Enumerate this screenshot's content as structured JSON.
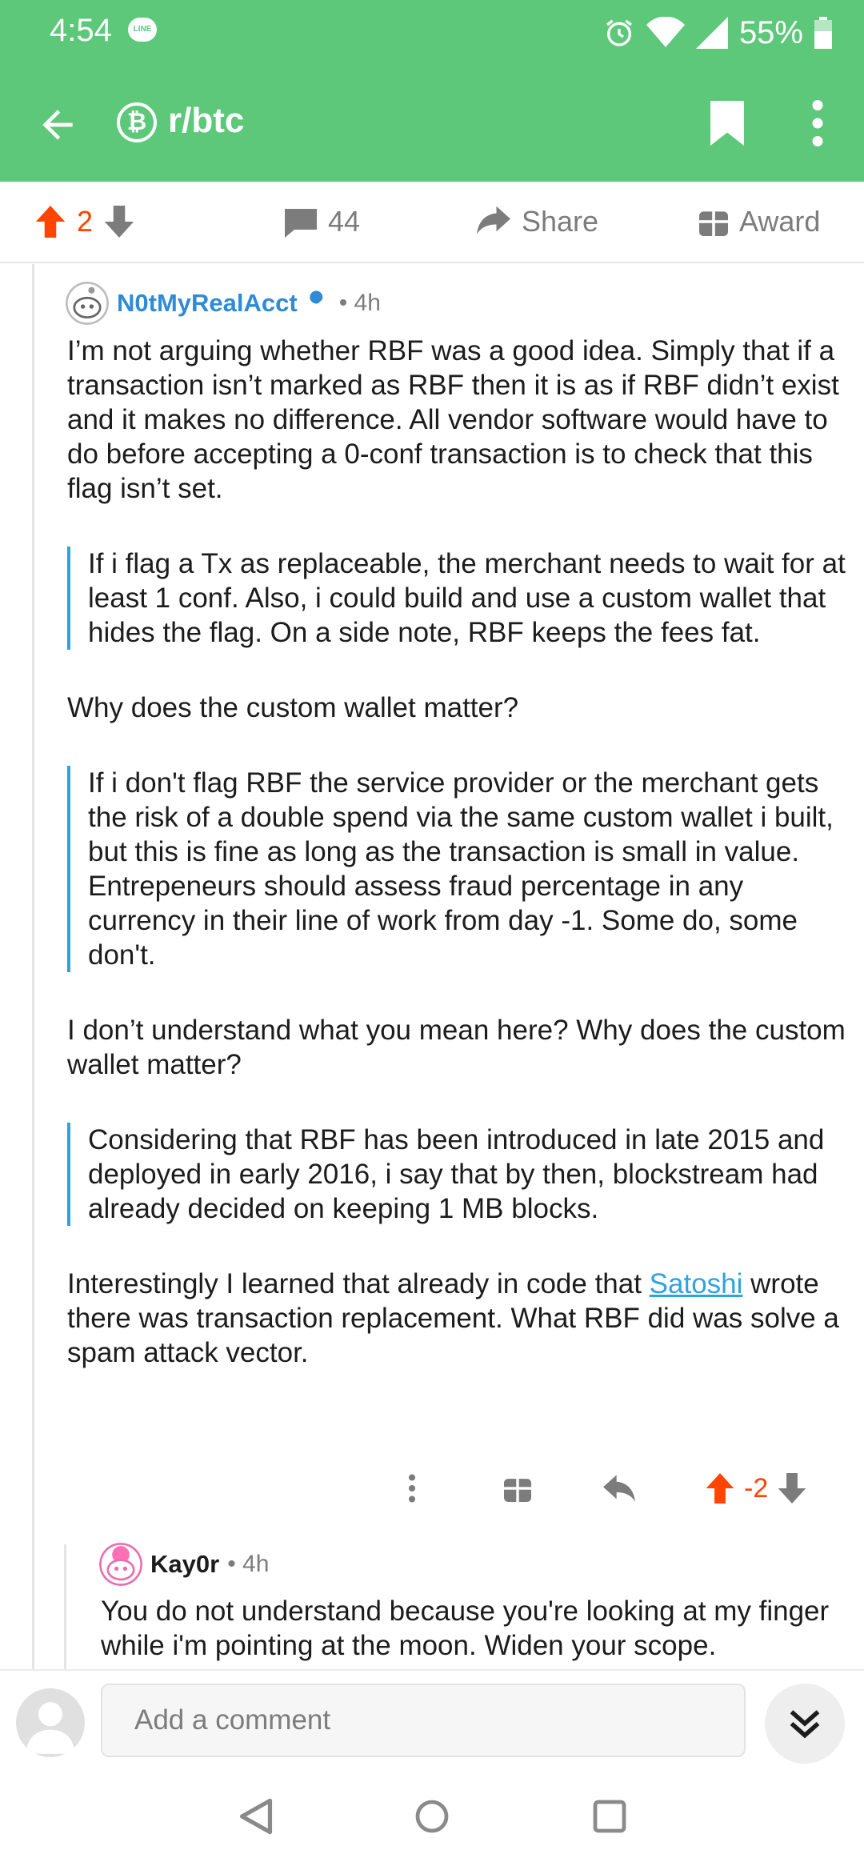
{
  "status_bar": {
    "time": "4:54",
    "line_badge": "LINE",
    "battery": "55%",
    "icons": [
      "alarm-icon",
      "wifi-icon",
      "signal-icon",
      "battery-icon"
    ]
  },
  "app_bar": {
    "subreddit": "r/btc",
    "subreddit_icon_glyph": "₿",
    "icons": [
      "back-arrow-icon",
      "bookmark-icon",
      "more-vertical-icon"
    ]
  },
  "post_actions": {
    "upvotes": "2",
    "comments": "44",
    "share_label": "Share",
    "award_label": "Award"
  },
  "comment": {
    "author": "N0tMyRealAcct",
    "age": "• 4h",
    "paragraphs": [
      {
        "type": "text",
        "text": "I’m not arguing whether RBF was a good idea. Simply that if a transaction isn’t marked as RBF then it is as if RBF didn’t exist and it makes no difference. All vendor software would have to do before accepting a 0-conf transaction is to check that this flag isn’t set."
      },
      {
        "type": "quote",
        "text": "If i flag a Tx as replaceable, the merchant needs to wait for at least 1 conf. Also, i could build and use a custom wallet that hides the flag. On a side note, RBF keeps the fees fat."
      },
      {
        "type": "text",
        "text": "Why does the custom wallet matter?"
      },
      {
        "type": "quote",
        "text": "If i don't flag RBF the service provider or the merchant gets the risk of a double spend via the same custom wallet i built, but this is fine as long as the transaction is small in value. Entrepeneurs should assess fraud percentage in any currency in their line of work from day -1. Some do, some don't."
      },
      {
        "type": "text",
        "text": "I don’t understand what you mean here? Why does the custom wallet matter?"
      },
      {
        "type": "quote",
        "text": "Considering that RBF has been introduced in late 2015 and deployed in early 2016, i say that by then, blockstream had already decided on keeping 1 MB blocks."
      }
    ],
    "last_paragraph": {
      "before_link": "Interestingly I learned that already in code that ",
      "link_text": "Satoshi",
      "after_link": " wrote there was transaction replacement. What RBF did was solve a spam attack vector."
    },
    "score": "-2"
  },
  "reply": {
    "author": "Kay0r",
    "age": "• 4h",
    "text": "You do not understand because you're looking at my finger while i'm pointing at the moon. Widen your scope."
  },
  "bottom_bar": {
    "comment_placeholder": "Add a comment"
  },
  "colors": {
    "header_green": "#5dc87a",
    "upvote_orange": "#ff4500",
    "link_blue": "#2ea3e0",
    "author_blue": "#2f8bd6"
  }
}
